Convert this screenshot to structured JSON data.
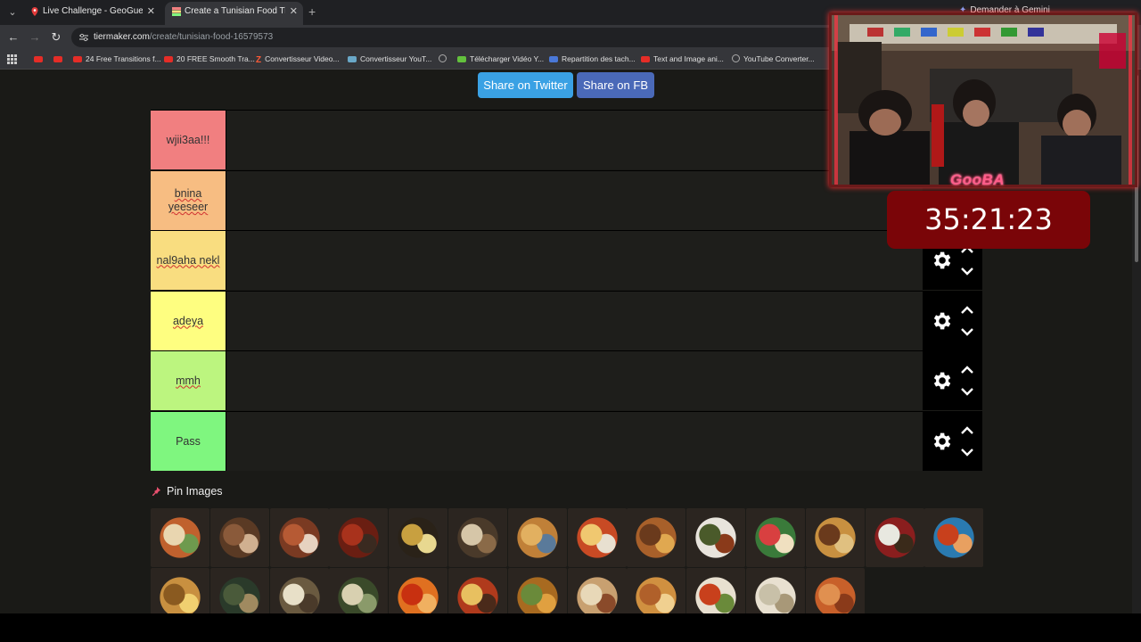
{
  "browser": {
    "tabs": [
      {
        "title": "Live Challenge - GeoGuessr",
        "active": false,
        "icon": "geoguessr-pin-icon"
      },
      {
        "title": "Create a Tunisian Food Tier List",
        "active": true,
        "icon": "tiermaker-icon"
      }
    ],
    "gemini_label": "Demander à Gemini",
    "url_host": "tiermaker.com",
    "url_path": "/create/tunisian-food-16579573"
  },
  "bookmarks": [
    {
      "label": "",
      "icon": "yt"
    },
    {
      "label": "",
      "icon": "yt"
    },
    {
      "label": "24 Free Transitions f...",
      "icon": "yt"
    },
    {
      "label": "20 FREE Smooth Tra...",
      "icon": "yt"
    },
    {
      "label": "Convertisseur Video...",
      "icon": "z"
    },
    {
      "label": "Convertisseur YouT...",
      "icon": "conv"
    },
    {
      "label": "",
      "icon": "globe"
    },
    {
      "label": "Télécharger Vidéo Y...",
      "icon": "green"
    },
    {
      "label": "Repartition des tach...",
      "icon": "blue"
    },
    {
      "label": "Text and Image ani...",
      "icon": "yt"
    },
    {
      "label": "YouTube Converter...",
      "icon": "globe"
    }
  ],
  "share": {
    "twitter": "Share on Twitter",
    "fb": "Share on FB"
  },
  "tiers": [
    {
      "label": "wjii3aa!!!",
      "color": "#f17f80",
      "spellcheck": false
    },
    {
      "label": "bnina yeeseer",
      "color": "#f7bd82",
      "spellcheck": true
    },
    {
      "label": "nal9aha nekl",
      "color": "#f9dd80",
      "spellcheck": true
    },
    {
      "label": "adeya",
      "color": "#fefe80",
      "spellcheck": true
    },
    {
      "label": "mmh",
      "color": "#bcf57f",
      "spellcheck": true
    },
    {
      "label": "Pass",
      "color": "#7ff67f",
      "spellcheck": false
    }
  ],
  "pin_images_label": "Pin Images",
  "overlay": {
    "streamer_name": "GooBA",
    "timer": "35:21:23"
  }
}
